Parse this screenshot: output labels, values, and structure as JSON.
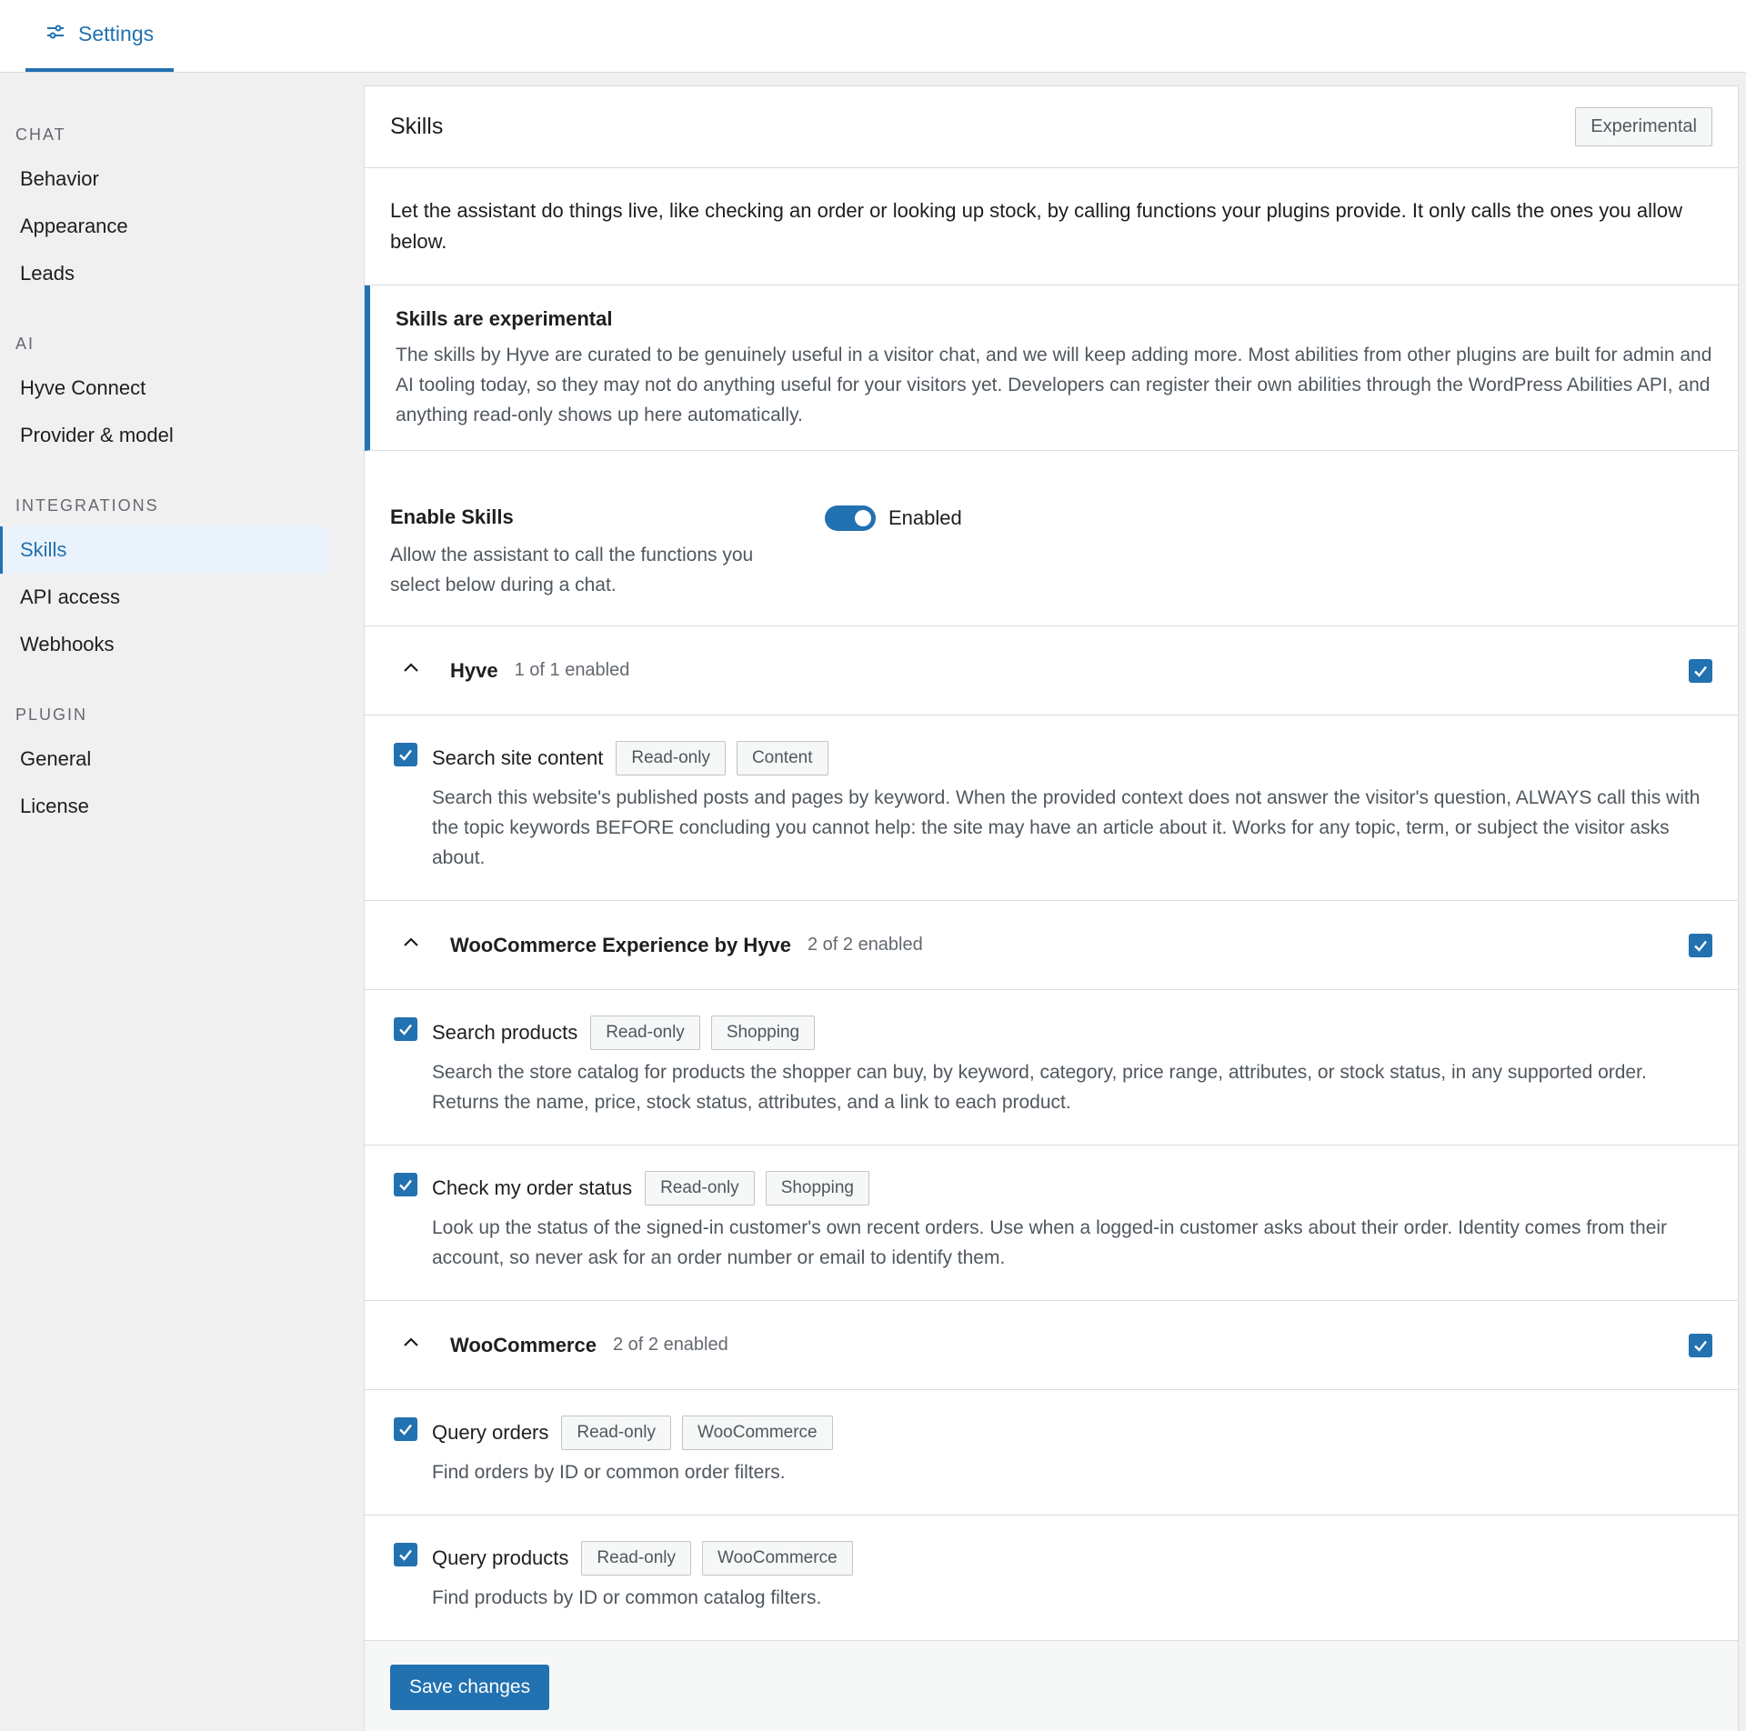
{
  "topbar": {
    "tab_label": "Settings"
  },
  "sidebar": {
    "groups": [
      {
        "heading": "CHAT",
        "items": [
          "Behavior",
          "Appearance",
          "Leads"
        ]
      },
      {
        "heading": "AI",
        "items": [
          "Hyve Connect",
          "Provider & model"
        ]
      },
      {
        "heading": "INTEGRATIONS",
        "items": [
          "Skills",
          "API access",
          "Webhooks"
        ]
      },
      {
        "heading": "PLUGIN",
        "items": [
          "General",
          "License"
        ]
      }
    ],
    "active_item": "Skills"
  },
  "card": {
    "title": "Skills",
    "badge": "Experimental",
    "intro": "Let the assistant do things live, like checking an order or looking up stock, by calling functions your plugins provide. It only calls the ones you allow below.",
    "notice": {
      "title": "Skills are experimental",
      "text": "The skills by Hyve are curated to be genuinely useful in a visitor chat, and we will keep adding more. Most abilities from other plugins are built for admin and AI tooling today, so they may not do anything useful for your visitors yet. Developers can register their own abilities through the WordPress Abilities API, and anything read-only shows up here automatically."
    },
    "enable": {
      "title": "Enable Skills",
      "desc": "Allow the assistant to call the functions you select below during a chat.",
      "toggle_label": "Enabled",
      "enabled": true
    },
    "groups": [
      {
        "name": "Hyve",
        "count": "1 of 1 enabled",
        "skills": [
          {
            "name": "Search site content",
            "tags": [
              "Read-only",
              "Content"
            ],
            "desc": "Search this website's published posts and pages by keyword. When the provided context does not answer the visitor's question, ALWAYS call this with the topic keywords BEFORE concluding you cannot help: the site may have an article about it. Works for any topic, term, or subject the visitor asks about."
          }
        ]
      },
      {
        "name": "WooCommerce Experience by Hyve",
        "count": "2 of 2 enabled",
        "skills": [
          {
            "name": "Search products",
            "tags": [
              "Read-only",
              "Shopping"
            ],
            "desc": "Search the store catalog for products the shopper can buy, by keyword, category, price range, attributes, or stock status, in any supported order. Returns the name, price, stock status, attributes, and a link to each product."
          },
          {
            "name": "Check my order status",
            "tags": [
              "Read-only",
              "Shopping"
            ],
            "desc": "Look up the status of the signed-in customer's own recent orders. Use when a logged-in customer asks about their order. Identity comes from their account, so never ask for an order number or email to identify them."
          }
        ]
      },
      {
        "name": "WooCommerce",
        "count": "2 of 2 enabled",
        "skills": [
          {
            "name": "Query orders",
            "tags": [
              "Read-only",
              "WooCommerce"
            ],
            "desc": "Find orders by ID or common order filters."
          },
          {
            "name": "Query products",
            "tags": [
              "Read-only",
              "WooCommerce"
            ],
            "desc": "Find products by ID or common catalog filters."
          }
        ]
      }
    ],
    "save_label": "Save changes"
  },
  "colors": {
    "accent": "#2271b1",
    "muted": "#50575e",
    "border": "#dcdcde"
  }
}
